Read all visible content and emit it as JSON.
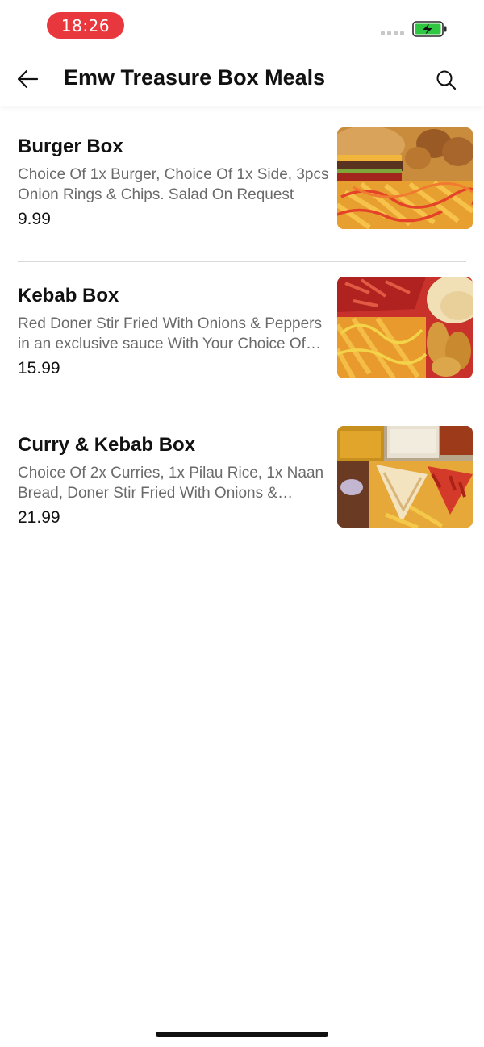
{
  "status_bar": {
    "time": "18:26",
    "time_pill_color": "#e8373d",
    "battery_color": "#2fc742",
    "battery_state": "charging"
  },
  "header": {
    "title": "Emw Treasure Box Meals",
    "back_icon": "arrow-left-icon",
    "search_icon": "search-icon"
  },
  "menu": {
    "items": [
      {
        "name": "Burger Box",
        "description": "Choice Of 1x Burger, Choice Of 1x Side, 3pcs Onion Rings & Chips. Salad On Request",
        "price": "9.99"
      },
      {
        "name": "Kebab Box",
        "description": "Red Doner Stir Fried With Onions & Peppers in an exclusive sauce With Your Choice Of Side",
        "price": "15.99"
      },
      {
        "name": "Curry & Kebab Box",
        "description": "Choice Of 2x Curries, 1x Pilau Rice, 1x Naan Bread, Doner Stir Fried With Onions & Peppers",
        "price": "21.99"
      }
    ]
  }
}
